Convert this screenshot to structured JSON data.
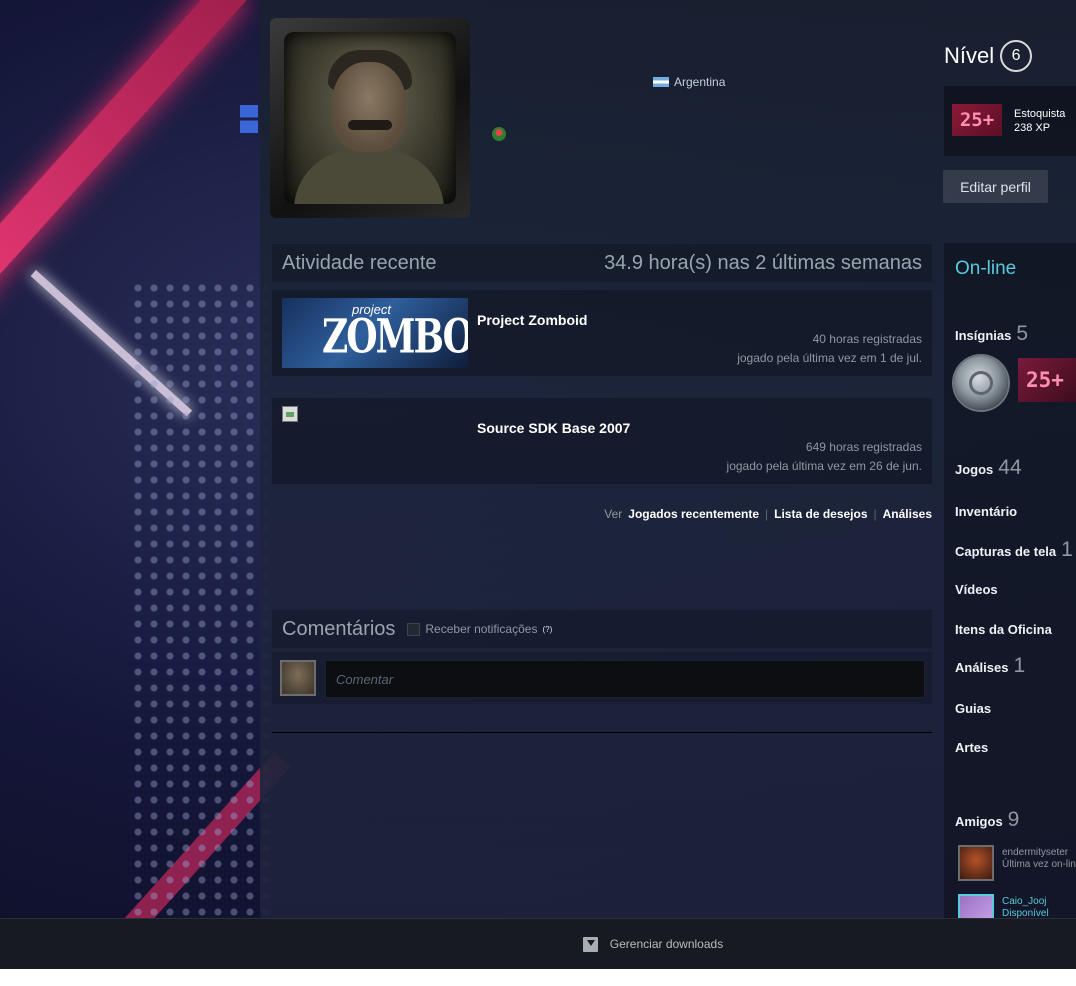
{
  "profile": {
    "country": "Argentina"
  },
  "level": {
    "label": "Nível",
    "value": "6",
    "badge_text": "25+",
    "badge_name": "Estoquista",
    "xp": "238 XP"
  },
  "buttons": {
    "edit_profile": "Editar perfil"
  },
  "activity": {
    "title": "Atividade recente",
    "summary": "34.9 hora(s) nas 2 últimas semanas",
    "games": [
      {
        "name": "Project Zomboid",
        "capsule_line1": "project",
        "capsule_line2": "ZOMBOID",
        "hours": "40 horas registradas",
        "last_played": "jogado pela última vez em 1 de jul."
      },
      {
        "name": "Source SDK Base 2007",
        "hours": "649 horas registradas",
        "last_played": "jogado pela última vez em 26 de jun."
      }
    ],
    "view_label": "Ver",
    "links": [
      "Jogados recentemente",
      "Lista de desejos",
      "Análises"
    ]
  },
  "comments": {
    "title": "Comentários",
    "notify_label": "Receber notificações",
    "help": "(?)",
    "placeholder": "Comentar"
  },
  "sidebar": {
    "status": "On-line",
    "badges": {
      "label": "Insígnias",
      "count": "5",
      "badge2_text": "25+"
    },
    "games": {
      "label": "Jogos",
      "count": "44"
    },
    "inventory": "Inventário",
    "screenshots": {
      "label": "Capturas de tela",
      "count": "1"
    },
    "videos": "Vídeos",
    "workshop": "Itens da Oficina",
    "reviews": {
      "label": "Análises",
      "count": "1"
    },
    "guides": "Guias",
    "artwork": "Artes",
    "friends": {
      "label": "Amigos",
      "count": "9"
    },
    "friend_list": [
      {
        "name": "endermityseter",
        "status": "Última vez on-line"
      },
      {
        "name": "Caio_Jooj",
        "status": "Disponível"
      }
    ]
  },
  "bottom_bar": {
    "downloads": "Gerenciar downloads"
  },
  "colors": {
    "online": "#57cbde",
    "accent_pink": "#ff3b7a",
    "panel": "#1c2536"
  }
}
